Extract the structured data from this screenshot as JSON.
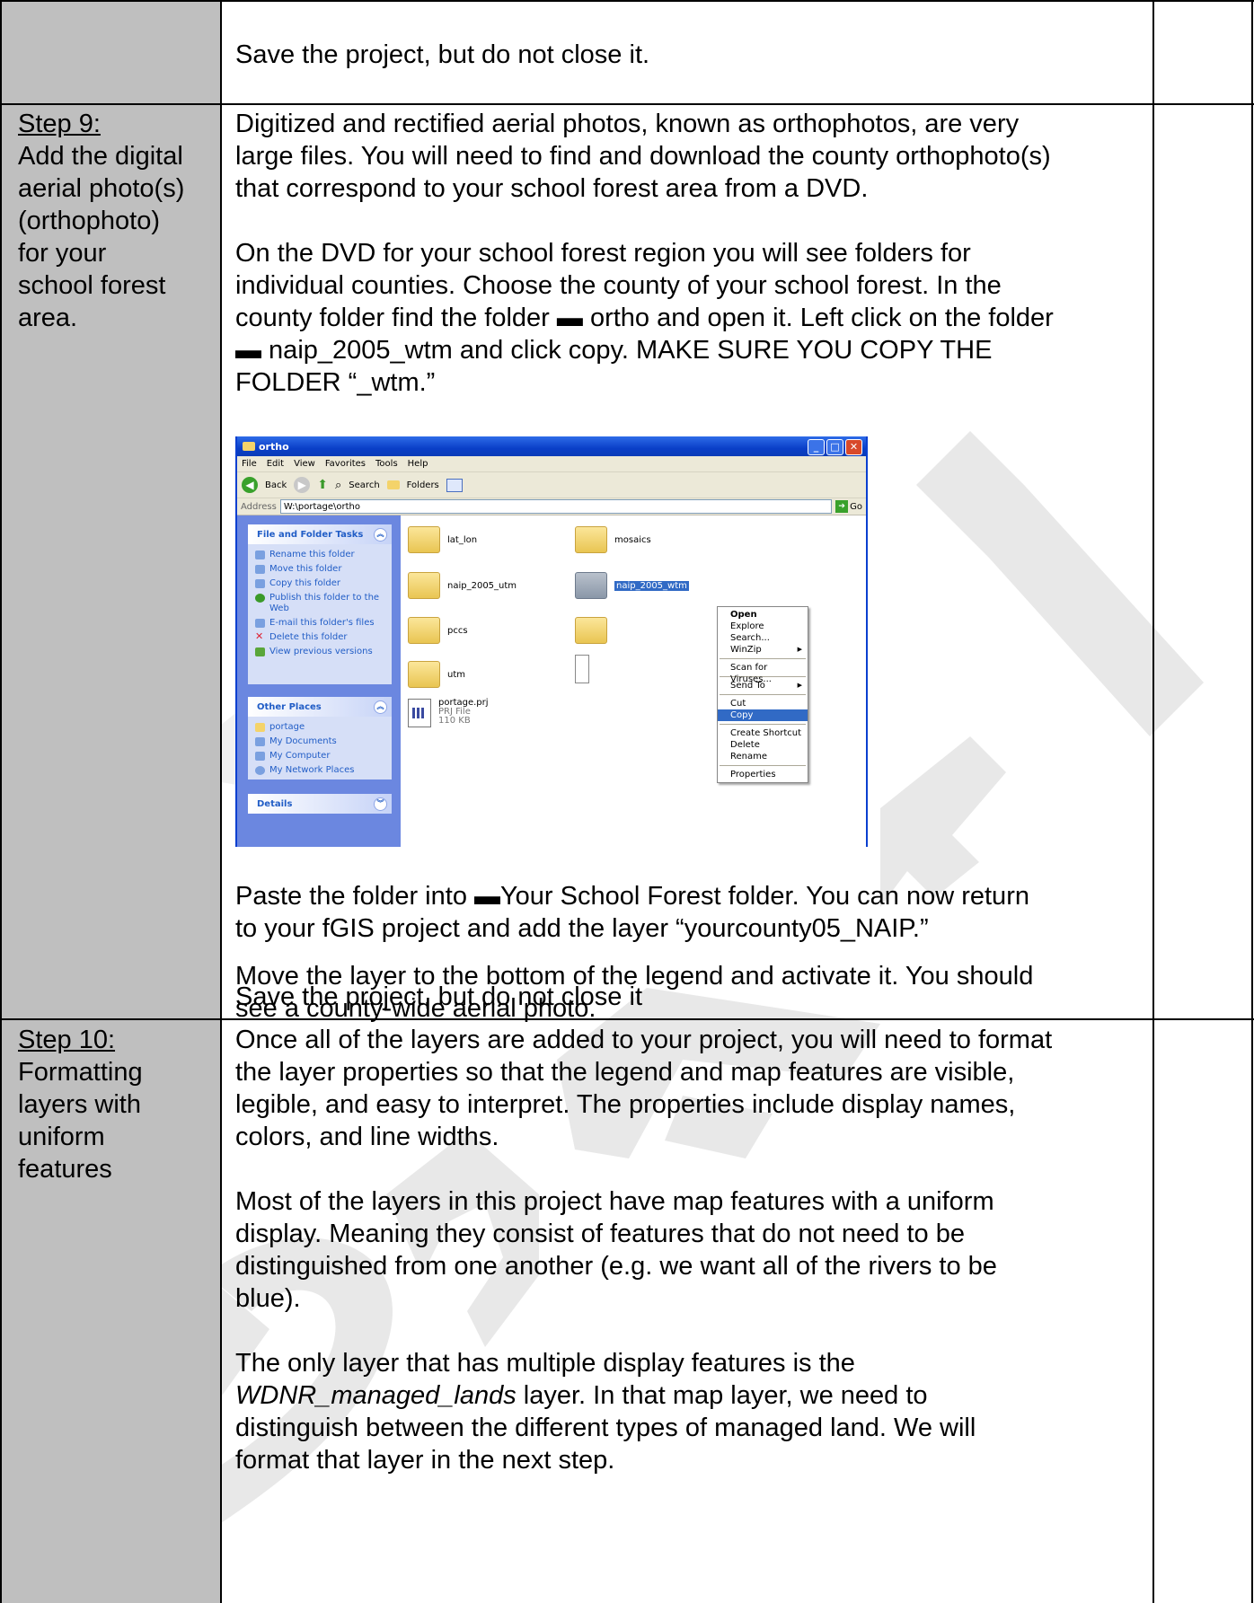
{
  "row_save_top": {
    "text": "Save the project, but do not close it."
  },
  "step9": {
    "label": "Step 9:",
    "desc_lines": [
      "Add the digital",
      "aerial photo(s)",
      "(orthophoto)",
      "for your",
      "school forest",
      "area."
    ],
    "para1_lines": [
      "Digitized and rectified aerial photos, known as orthophotos, are very",
      "large files. You will need to find and download the county orthophoto(s)",
      "that correspond to your school forest area from a DVD."
    ],
    "para2_lines": [
      "On the DVD for your school forest region you will see folders for",
      "individual counties. Choose the county of your school forest. In the",
      "county folder find the folder ▬ ortho and open it. Left click on the folder",
      "▬ naip_2005_wtm and click copy. MAKE SURE YOU COPY THE",
      "FOLDER “_wtm.”"
    ],
    "para3_lines": [
      "Paste the folder into ▬Your School Forest folder. You can now return",
      "to your fGIS project and add the layer “yourcounty05_NAIP.”"
    ],
    "para4_lines": [
      "Move the layer to the bottom of the legend and activate it. You should",
      "see a county-wide aerial photo."
    ],
    "para5": "Save the project, but do not close it"
  },
  "explorer": {
    "title": "ortho",
    "menu": [
      "File",
      "Edit",
      "View",
      "Favorites",
      "Tools",
      "Help"
    ],
    "toolbar": {
      "back": "Back",
      "search": "Search",
      "folders": "Folders"
    },
    "address_label": "Address",
    "address_value": "W:\\portage\\ortho",
    "go_label": "Go",
    "tasks_title": "File and Folder Tasks",
    "tasks": [
      "Rename this folder",
      "Move this folder",
      "Copy this folder",
      "Publish this folder to the Web",
      "E-mail this folder's files",
      "Delete this folder",
      "View previous versions"
    ],
    "places_title": "Other Places",
    "places": [
      "portage",
      "My Documents",
      "My Computer",
      "My Network Places"
    ],
    "details_title": "Details",
    "files": {
      "lat_lon": "lat_lon",
      "mosaics": "mosaics",
      "naip_utm": "naip_2005_utm",
      "naip_wtm": "naip_2005_wtm",
      "pccs": "pccs",
      "utm": "utm",
      "prj_name": "portage.prj",
      "prj_type": "PRJ File",
      "prj_size": "110 KB"
    },
    "context_menu": [
      "Open",
      "Explore",
      "Search...",
      "WinZip",
      "Scan for Viruses...",
      "Send To",
      "Cut",
      "Copy",
      "Create Shortcut",
      "Delete",
      "Rename",
      "Properties"
    ]
  },
  "step10": {
    "label": "Step 10:",
    "desc_lines": [
      "Formatting",
      "layers with",
      "uniform",
      "features"
    ],
    "para1_lines": [
      "Once all of the layers are added to your project, you will need to format",
      "the layer properties so that the legend and map features are visible,",
      "legible, and easy to interpret. The properties include display names,",
      "colors, and line widths."
    ],
    "para2_lines": [
      "Most of the layers in this project have map features with a uniform",
      "display. Meaning they consist of features that do not need to be",
      "distinguished from one another (e.g. we want all of the rivers to be",
      "blue)."
    ],
    "para3_line1": "The only layer that has multiple display features is the",
    "para3_italic": "WDNR_managed_lands",
    "para3_line2_rest": " layer. In that map layer, we need to",
    "para3_lines_rest": [
      "distinguish between the different types of managed land. We will",
      "format that layer in the next step."
    ]
  },
  "colors": {
    "shade": "#bfbfbf",
    "watermark": "#e6e6e6",
    "selection": "#316ac5"
  }
}
